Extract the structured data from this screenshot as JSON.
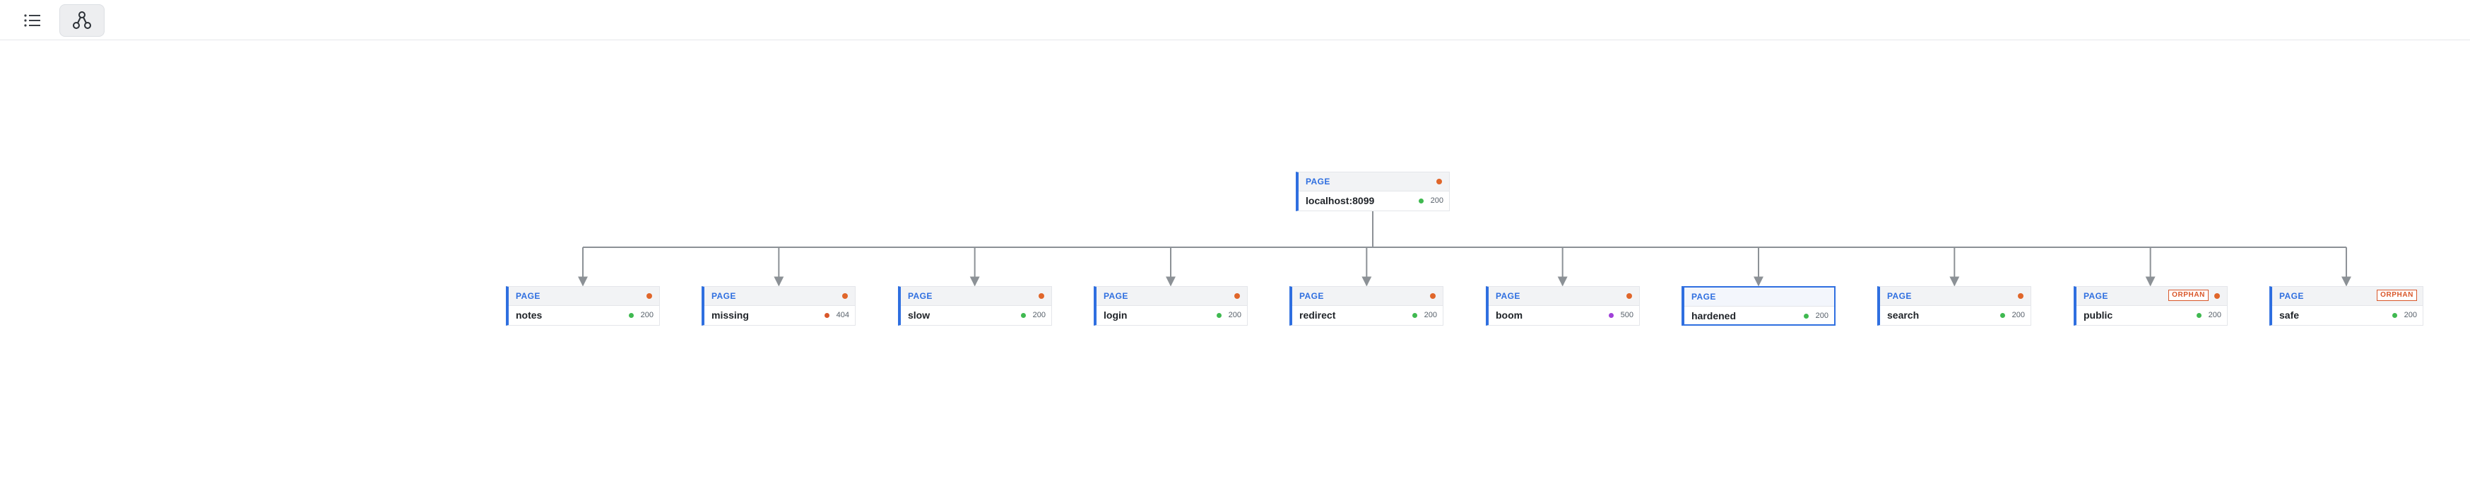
{
  "toolbar": {
    "buttons": [
      {
        "icon": "list-icon",
        "active": false
      },
      {
        "icon": "graph-icon",
        "active": true
      }
    ]
  },
  "colors": {
    "accent": "#2f6fe0",
    "dot_orange": "#e0662a",
    "status_ok": "#3fb950",
    "status_404": "#d9572a",
    "status_500": "#a040d8",
    "orphan": "#d9572a",
    "edge": "#8c9196"
  },
  "graph": {
    "root": {
      "type": "PAGE",
      "label": "localhost:8099",
      "status": "200",
      "status_color": "#3fb950",
      "dot": true,
      "orphan": false,
      "selected": false
    },
    "children": [
      {
        "type": "PAGE",
        "label": "notes",
        "status": "200",
        "status_color": "#3fb950",
        "dot": true,
        "orphan": false,
        "selected": false
      },
      {
        "type": "PAGE",
        "label": "missing",
        "status": "404",
        "status_color": "#d9572a",
        "dot": true,
        "orphan": false,
        "selected": false
      },
      {
        "type": "PAGE",
        "label": "slow",
        "status": "200",
        "status_color": "#3fb950",
        "dot": true,
        "orphan": false,
        "selected": false
      },
      {
        "type": "PAGE",
        "label": "login",
        "status": "200",
        "status_color": "#3fb950",
        "dot": true,
        "orphan": false,
        "selected": false
      },
      {
        "type": "PAGE",
        "label": "redirect",
        "status": "200",
        "status_color": "#3fb950",
        "dot": true,
        "orphan": false,
        "selected": false
      },
      {
        "type": "PAGE",
        "label": "boom",
        "status": "500",
        "status_color": "#a040d8",
        "dot": true,
        "orphan": false,
        "selected": false
      },
      {
        "type": "PAGE",
        "label": "hardened",
        "status": "200",
        "status_color": "#3fb950",
        "dot": false,
        "orphan": false,
        "selected": true
      },
      {
        "type": "PAGE",
        "label": "search",
        "status": "200",
        "status_color": "#3fb950",
        "dot": true,
        "orphan": false,
        "selected": false
      },
      {
        "type": "PAGE",
        "label": "public",
        "status": "200",
        "status_color": "#3fb950",
        "dot": true,
        "orphan": true,
        "orphan_label": "ORPHAN",
        "selected": false
      },
      {
        "type": "PAGE",
        "label": "safe",
        "status": "200",
        "status_color": "#3fb950",
        "dot": false,
        "orphan": true,
        "orphan_label": "ORPHAN",
        "selected": false
      }
    ]
  }
}
